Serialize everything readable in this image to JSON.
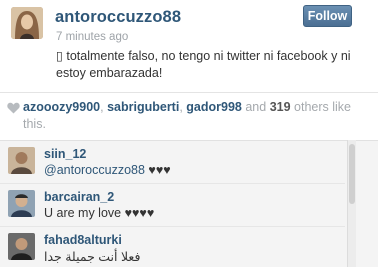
{
  "post": {
    "username": "antoroccuzzo88",
    "timestamp": "7 minutes ago",
    "follow_label": "Follow",
    "caption": "▯ totalmente falso, no tengo ni twitter ni facebook y ni estoy embarazada!"
  },
  "likes": {
    "users": [
      "azooozy9900",
      "sabriguberti",
      "gador998"
    ],
    "separator_1": ", ",
    "separator_2": ", ",
    "and_text": " and ",
    "count": "319",
    "suffix": " others like this."
  },
  "comments": [
    {
      "username": "siin_12",
      "mention": "@antoroccuzzo88",
      "text": " ♥♥♥"
    },
    {
      "username": "barcairan_2",
      "mention": "",
      "text": "U are my love ♥♥♥♥"
    },
    {
      "username": "fahad8alturki",
      "mention": "",
      "text": "فعلا أنت جميلة جدا"
    }
  ],
  "colors": {
    "username_blue": "#2f5778",
    "follow_bg": "#5b80a4",
    "muted_gray": "#a5a9ad"
  },
  "icons": {
    "like": "heart-icon"
  }
}
